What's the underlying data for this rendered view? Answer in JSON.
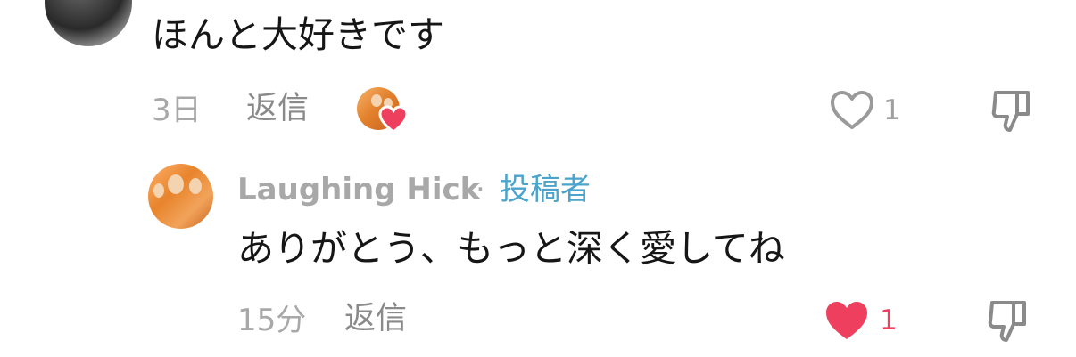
{
  "comment": {
    "text": "ほんと大好きです",
    "time": "3日",
    "reply_label": "返信",
    "like_count": "1",
    "liked_by_creator": true,
    "liked": false
  },
  "reply": {
    "author": "Laughing Hick",
    "separator": "·",
    "badge": "投稿者",
    "text": "ありがとう、もっと深く愛してね",
    "time": "15分",
    "reply_label": "返信",
    "like_count": "1",
    "liked": true
  },
  "colors": {
    "like_red": "#ef3f5e",
    "creator_badge": "#4aa4cc",
    "meta_gray": "#a8a8a8"
  },
  "icons": {
    "like": "heart-icon",
    "dislike": "thumbs-down-icon"
  }
}
